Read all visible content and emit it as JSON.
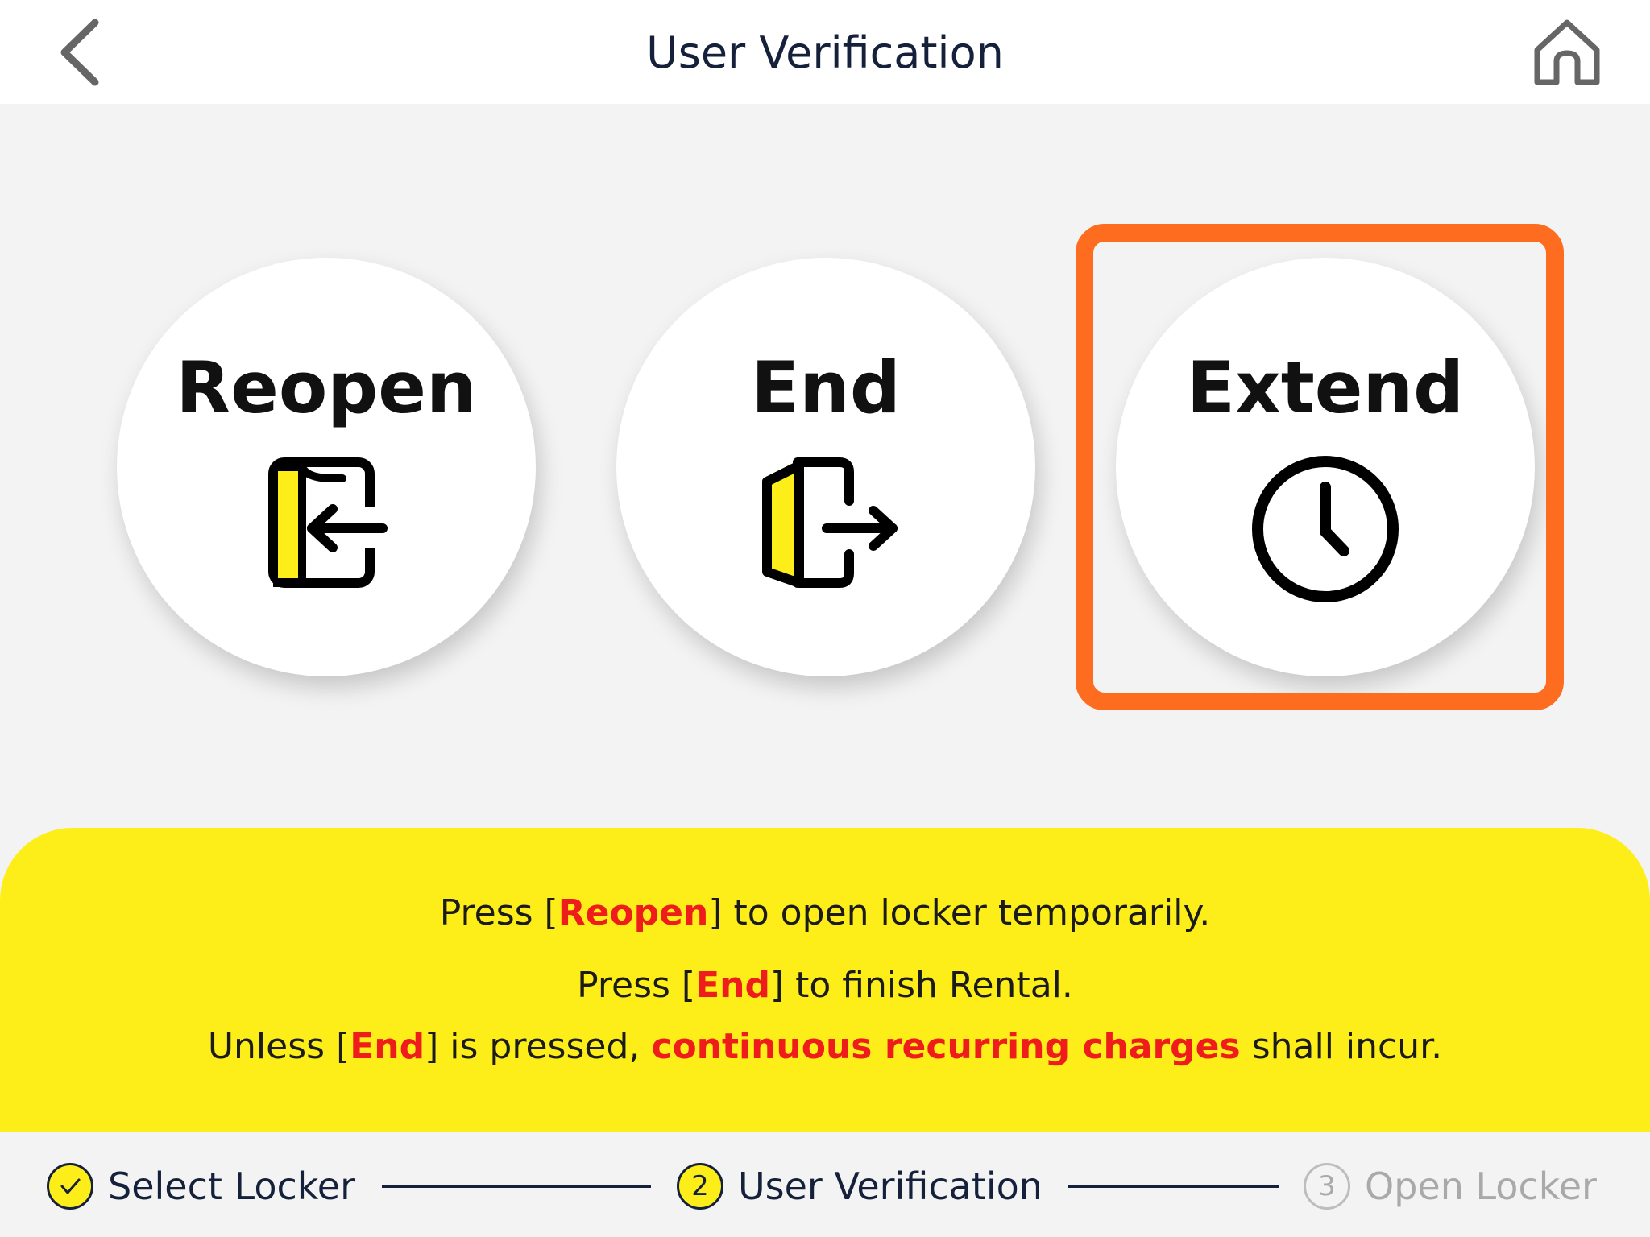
{
  "header": {
    "title": "User Verification"
  },
  "actions": [
    {
      "label": "Reopen",
      "icon": "door-enter-icon"
    },
    {
      "label": "End",
      "icon": "door-exit-icon"
    },
    {
      "label": "Extend",
      "icon": "clock-icon"
    }
  ],
  "highlighted_action": "Extend",
  "info": {
    "line1": {
      "pre": "Press [",
      "hl": "Reopen",
      "post": "] to open locker temporarily."
    },
    "line2": {
      "pre": "Press [",
      "hl": "End",
      "post": "] to finish Rental."
    },
    "line3": {
      "pre": "Unless [",
      "hl": "End",
      "mid": "] is pressed, ",
      "hl2": "continuous recurring charges",
      "post": " shall incur."
    }
  },
  "steps": [
    {
      "marker": "✓",
      "label": "Select Locker",
      "state": "done"
    },
    {
      "marker": "2",
      "label": "User Verification",
      "state": "current"
    },
    {
      "marker": "3",
      "label": "Open Locker",
      "state": "pending"
    }
  ],
  "colors": {
    "accent_yellow": "#fdee1a",
    "highlight_orange": "#fd6c1f",
    "emphasis_red": "#ef1c1c",
    "navy": "#15203b"
  }
}
